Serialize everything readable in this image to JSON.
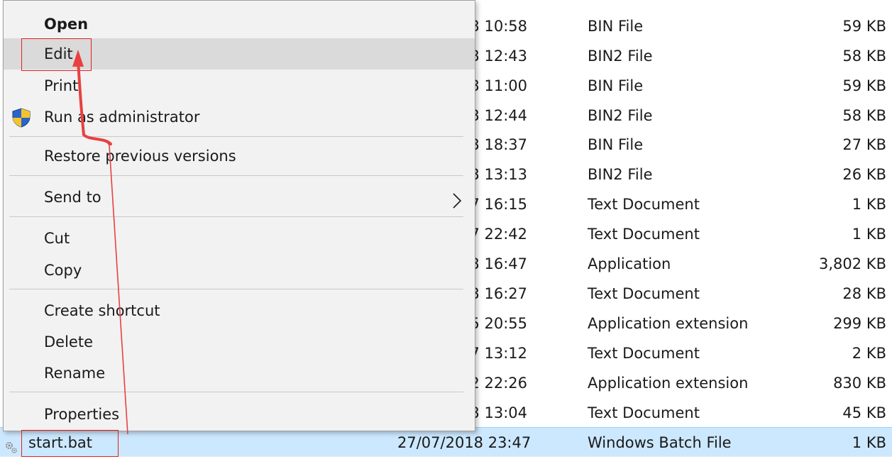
{
  "files": [
    {
      "date": "3 10:58",
      "type": "BIN File",
      "size": "59 KB"
    },
    {
      "date": "3 12:43",
      "type": "BIN2 File",
      "size": "58 KB"
    },
    {
      "date": "3 11:00",
      "type": "BIN File",
      "size": "59 KB"
    },
    {
      "date": "3 12:44",
      "type": "BIN2 File",
      "size": "58 KB"
    },
    {
      "date": "3 18:37",
      "type": "BIN File",
      "size": "27 KB"
    },
    {
      "date": "3 13:13",
      "type": "BIN2 File",
      "size": "26 KB"
    },
    {
      "date": "7 16:15",
      "type": "Text Document",
      "size": "1 KB"
    },
    {
      "date": "7 22:42",
      "type": "Text Document",
      "size": "1 KB"
    },
    {
      "date": "3 16:47",
      "type": "Application",
      "size": "3,802 KB"
    },
    {
      "date": "3 16:27",
      "type": "Text Document",
      "size": "28 KB"
    },
    {
      "date": "5 20:55",
      "type": "Application extension",
      "size": "299 KB"
    },
    {
      "date": "7 13:12",
      "type": "Text Document",
      "size": "2 KB"
    },
    {
      "date": "2 22:26",
      "type": "Application extension",
      "size": "830 KB"
    },
    {
      "date": "3 13:04",
      "type": "Text Document",
      "size": "45 KB"
    }
  ],
  "selected_file": {
    "name": "start.bat",
    "date": "27/07/2018 23:47",
    "type": "Windows Batch File",
    "size": "1 KB"
  },
  "context_menu": {
    "open": "Open",
    "edit": "Edit",
    "print": "Print",
    "run_as_admin": "Run as administrator",
    "restore_previous": "Restore previous versions",
    "send_to": "Send to",
    "cut": "Cut",
    "copy": "Copy",
    "create_shortcut": "Create shortcut",
    "delete": "Delete",
    "rename": "Rename",
    "properties": "Properties"
  },
  "colors": {
    "selection": "#cce8ff",
    "menu_background": "#f2f2f2",
    "menu_highlight": "#dadada",
    "annotation": "#e02020"
  }
}
